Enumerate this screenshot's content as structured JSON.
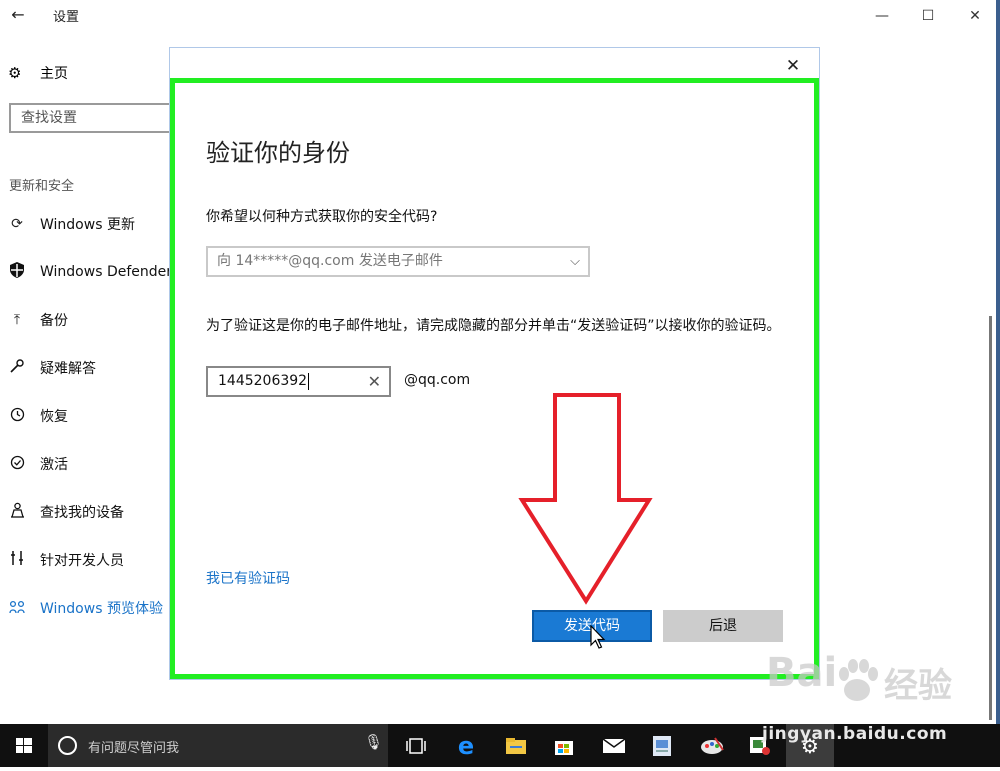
{
  "window": {
    "title": "设置",
    "back_icon": "back-arrow-icon",
    "controls": {
      "minimize": "—",
      "maximize": "☐",
      "close": "✕"
    }
  },
  "sidebar": {
    "home": {
      "label": "主页",
      "icon": "gear-icon"
    },
    "search_placeholder": "查找设置",
    "section_title": "更新和安全",
    "items": [
      {
        "label": "Windows 更新",
        "icon": "sync-icon",
        "active": false
      },
      {
        "label": "Windows Defender",
        "icon": "shield-icon",
        "active": false
      },
      {
        "label": "备份",
        "icon": "upload-icon",
        "active": false
      },
      {
        "label": "疑难解答",
        "icon": "wrench-icon",
        "active": false
      },
      {
        "label": "恢复",
        "icon": "history-icon",
        "active": false
      },
      {
        "label": "激活",
        "icon": "check-circle-icon",
        "active": false
      },
      {
        "label": "查找我的设备",
        "icon": "person-location-icon",
        "active": false
      },
      {
        "label": "针对开发人员",
        "icon": "developer-icon",
        "active": false
      },
      {
        "label": "Windows 预览体验",
        "icon": "insider-icon",
        "active": true
      }
    ]
  },
  "dialog": {
    "close": "✕",
    "heading": "验证你的身份",
    "question": "你希望以何种方式获取你的安全代码?",
    "selected_method": "向 14*****@qq.com 发送电子邮件",
    "instruction": "为了验证这是你的电子邮件地址，请完成隐藏的部分并单击“发送验证码”以接收你的验证码。",
    "email_input_value": "1445206392",
    "email_domain": "@qq.com",
    "have_code_link": "我已有验证码",
    "send_button": "发送代码",
    "back_button": "后退"
  },
  "taskbar": {
    "search_placeholder": "有问题尽管问我",
    "icons": [
      "windows-start-icon",
      "cortana-icon",
      "microphone-icon",
      "task-view-icon",
      "edge-icon",
      "file-explorer-icon",
      "store-icon",
      "mail-icon",
      "photo-app-icon",
      "paint-app-icon",
      "image-viewer-icon",
      "settings-icon"
    ]
  },
  "watermark": {
    "brand": "Bai",
    "brand_cn": "经验",
    "url": "jingyan.baidu.com"
  },
  "colors": {
    "accent": "#1a73c8",
    "highlight_frame": "#22ee22",
    "arrow": "#e5202a",
    "send_button": "#1a7ad4",
    "taskbar": "#101010"
  }
}
